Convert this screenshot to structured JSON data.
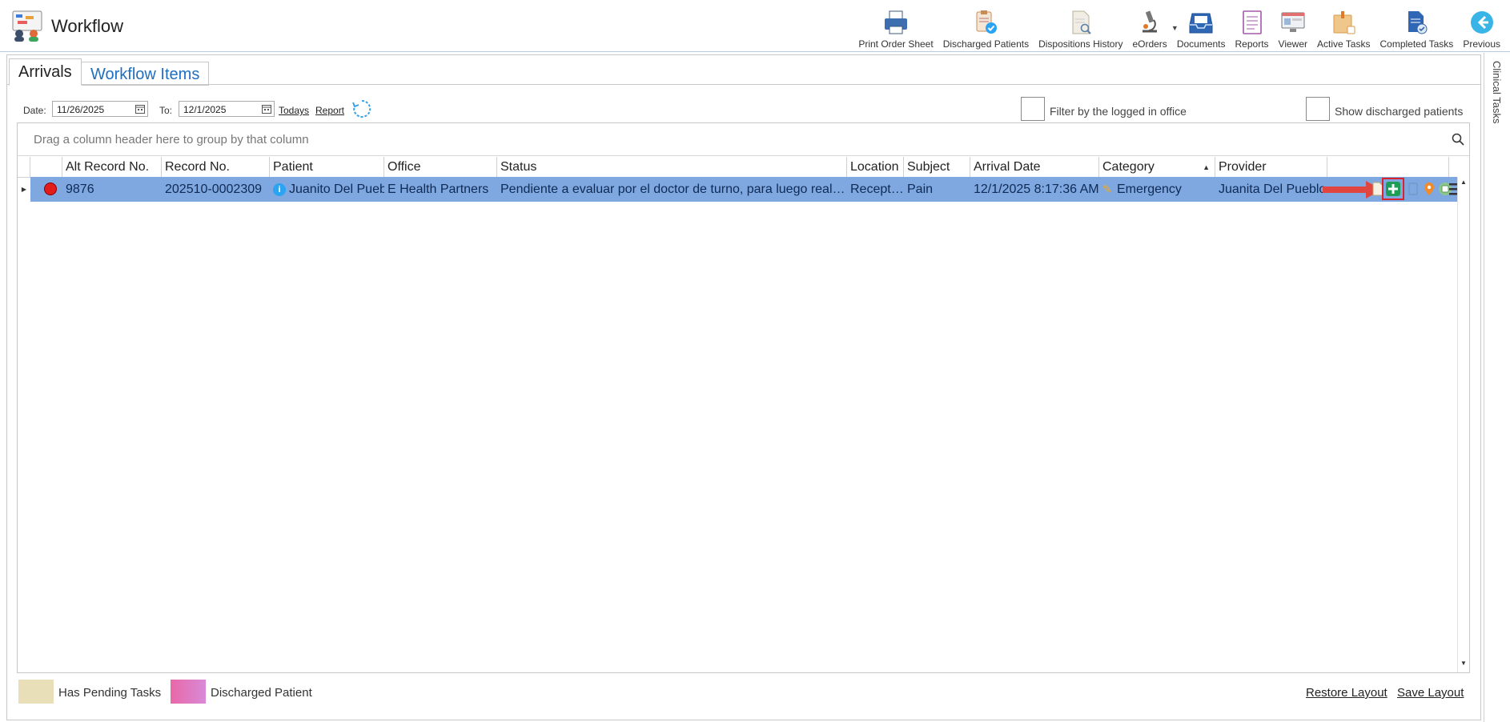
{
  "app": {
    "title": "Workflow"
  },
  "toolbar": [
    {
      "label": "Print Order Sheet",
      "icon": "printer-icon"
    },
    {
      "label": "Discharged Patients",
      "icon": "discharged-clipboard-icon"
    },
    {
      "label": "Dispositions History",
      "icon": "document-search-icon"
    },
    {
      "label": "eOrders",
      "icon": "microscope-icon"
    },
    {
      "label": "Documents",
      "icon": "inbox-tray-icon"
    },
    {
      "label": "Reports",
      "icon": "report-list-icon"
    },
    {
      "label": "Viewer",
      "icon": "monitor-icon"
    },
    {
      "label": "Active Tasks",
      "icon": "task-box-icon"
    },
    {
      "label": "Completed Tasks",
      "icon": "completed-doc-icon"
    },
    {
      "label": "Previous",
      "icon": "back-arrow-icon"
    }
  ],
  "side_tab": {
    "label": "Clinical Tasks"
  },
  "tabs": {
    "arrivals": "Arrivals",
    "workflow": "Workflow Items"
  },
  "filters": {
    "date_label": "Date:",
    "from_date": "11/26/2025",
    "to_label": "To:",
    "to_date": "12/1/2025",
    "todays": "Todays",
    "report": "Report",
    "filter_office_label": "Filter by the logged in office",
    "show_discharged_label": "Show discharged patients"
  },
  "grid": {
    "group_hint": "Drag a column header here to group by that column",
    "columns": {
      "alt_record": "Alt Record No.",
      "record": "Record No.",
      "patient": "Patient",
      "office": "Office",
      "status": "Status",
      "location": "Location",
      "subject": "Subject",
      "arrival": "Arrival Date",
      "category": "Category",
      "provider": "Provider"
    },
    "rows": [
      {
        "alt_record": "9876",
        "record": "202510-0002309",
        "patient": "Juanito Del Pueblo",
        "office": "E Health Partners",
        "status": "Pendiente a evaluar por el doctor de turno, para luego realizar",
        "location": "Reception",
        "subject": "Pain",
        "arrival": "12/1/2025 8:17:36 AM",
        "category": "Emergency",
        "provider": "Juanita Del Pueblo"
      }
    ]
  },
  "legend": {
    "pending": "Has Pending Tasks",
    "discharged": "Discharged Patient",
    "pending_color": "#e8dfb8",
    "discharged_color": "#e868a8"
  },
  "footer": {
    "restore": "Restore Layout",
    "save": "Save Layout"
  },
  "colors": {
    "selected_row": "#7fa8e1",
    "accent": "#1f6fc1",
    "highlight_box": "#d9232d"
  }
}
